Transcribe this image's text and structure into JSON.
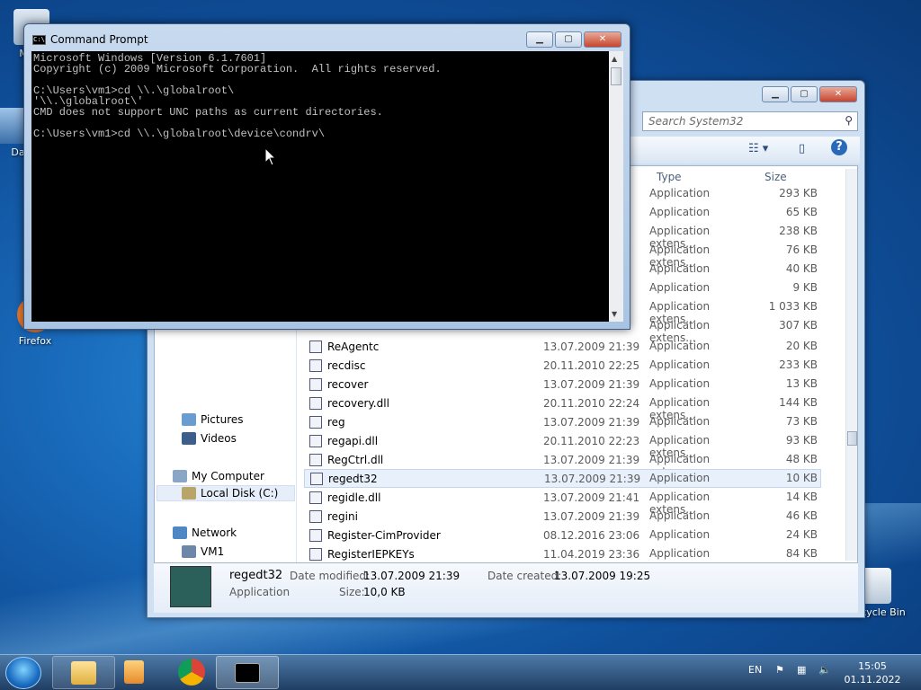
{
  "desktop": {
    "icons": [
      {
        "label": "My C"
      },
      {
        "label": "Data"
      },
      {
        "label": "Firefox"
      },
      {
        "label": "Recycle Bin"
      }
    ]
  },
  "explorer": {
    "search_placeholder": "Search System32",
    "columns": {
      "type": "Type",
      "size": "Size"
    },
    "upper_rows": [
      {
        "type": "Application",
        "size": "293 KB"
      },
      {
        "type": "Application",
        "size": "65 KB"
      },
      {
        "type": "Application extens...",
        "size": "238 KB"
      },
      {
        "type": "Application extens...",
        "size": "76 KB"
      },
      {
        "type": "Application",
        "size": "40 KB"
      },
      {
        "type": "Application",
        "size": "9 KB"
      },
      {
        "type": "Application extens...",
        "size": "1 033 KB"
      },
      {
        "type": "Application extens...",
        "size": "307 KB"
      }
    ],
    "nav": {
      "pictures": "Pictures",
      "videos": "Videos",
      "my_computer": "My Computer",
      "local_disk": "Local Disk (C:)",
      "network": "Network",
      "vm1": "VM1"
    },
    "files": [
      {
        "name": "ReAgentc",
        "date": "13.07.2009 21:39",
        "type": "Application",
        "size": "20 KB"
      },
      {
        "name": "recdisc",
        "date": "20.11.2010 22:25",
        "type": "Application",
        "size": "233 KB"
      },
      {
        "name": "recover",
        "date": "13.07.2009 21:39",
        "type": "Application",
        "size": "13 KB"
      },
      {
        "name": "recovery.dll",
        "date": "20.11.2010 22:24",
        "type": "Application extens...",
        "size": "144 KB"
      },
      {
        "name": "reg",
        "date": "13.07.2009 21:39",
        "type": "Application",
        "size": "73 KB"
      },
      {
        "name": "regapi.dll",
        "date": "20.11.2010 22:23",
        "type": "Application extens...",
        "size": "93 KB"
      },
      {
        "name": "RegCtrl.dll",
        "date": "13.07.2009 21:39",
        "type": "Application extens...",
        "size": "48 KB"
      },
      {
        "name": "regedt32",
        "date": "13.07.2009 21:39",
        "type": "Application",
        "size": "10 KB"
      },
      {
        "name": "regidle.dll",
        "date": "13.07.2009 21:41",
        "type": "Application extens...",
        "size": "14 KB"
      },
      {
        "name": "regini",
        "date": "13.07.2009 21:39",
        "type": "Application",
        "size": "46 KB"
      },
      {
        "name": "Register-CimProvider",
        "date": "08.12.2016 23:06",
        "type": "Application",
        "size": "24 KB"
      },
      {
        "name": "RegisterIEPKEYs",
        "date": "11.04.2019 23:36",
        "type": "Application",
        "size": "84 KB"
      }
    ],
    "details": {
      "name": "regedt32",
      "kind": "Application",
      "modified_label": "Date modified:",
      "modified": "13.07.2009 21:39",
      "created_label": "Date created:",
      "created": "13.07.2009 19:25",
      "size_label": "Size:",
      "size": "10,0 KB"
    }
  },
  "cmd": {
    "title": "Command Prompt",
    "lines": "Microsoft Windows [Version 6.1.7601]\nCopyright (c) 2009 Microsoft Corporation.  All rights reserved.\n\nC:\\Users\\vm1>cd \\\\.\\globalroot\\\n'\\\\.\\globalroot\\'\nCMD does not support UNC paths as current directories.\n\nC:\\Users\\vm1>cd \\\\.\\globalroot\\device\\condrv\\"
  },
  "taskbar": {
    "lang": "EN",
    "time": "15:05",
    "date": "01.11.2022"
  }
}
